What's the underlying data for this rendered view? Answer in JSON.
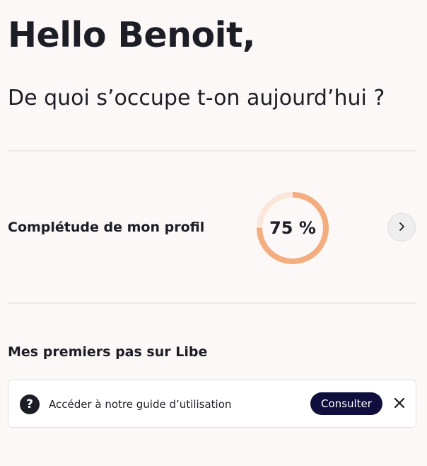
{
  "header": {
    "greeting": "Hello Benoit,",
    "subtitle": "De quoi s’occupe t-on aujourd’hui ?"
  },
  "profile": {
    "label": "Complétude de mon profil",
    "completion_percent": 75,
    "completion_text": "75 %",
    "ring_color": "#f4ad7f",
    "ring_track_color": "#fbe6da",
    "arrow_icon": "chevron-right-icon"
  },
  "first_steps": {
    "title": "Mes premiers pas sur Libe",
    "guide": {
      "icon": "question-circle-icon",
      "text": "Accéder à notre guide d’utilisation",
      "button_label": "Consulter",
      "close_icon": "close-icon"
    }
  },
  "colors": {
    "background": "#fcf8f7",
    "text": "#1d1d26",
    "button_primary": "#0f0e3d"
  }
}
